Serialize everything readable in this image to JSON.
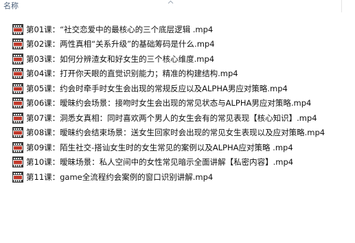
{
  "header": {
    "name_label": "名称"
  },
  "icons": {
    "sort": "sort-chevron-up-icon",
    "file": "video-file-icon"
  },
  "colors": {
    "header_text": "#4c607a",
    "file_text": "#111111",
    "icon_frame": "#3a3a3a",
    "icon_screen": "#c0392b"
  },
  "files": [
    {
      "name": "第01课：“社交恋爱中的最核心的三个底层逻辑 .mp4"
    },
    {
      "name": "第02课：两性真相“关系升级”的基础筹码是什么.mp4"
    },
    {
      "name": "第03课：如何分辨渣女和好女生的三个核心维度.mp4"
    },
    {
      "name": "第04课：打开你天眼的直觉识别能力；精准的构建结构.mp4"
    },
    {
      "name": "第05课：约会时牵手时女生会出现的常规反应以及ALPHA男应对策略.mp4"
    },
    {
      "name": "第06课：暧昧约会场景：接吻时女生会出现的常见状态与ALPHA男应对策略.mp4"
    },
    {
      "name": "第07课：洞悉女真相：同时喜欢两个男人的女生会有的常见表现【核心知识】.mp4"
    },
    {
      "name": "第08课：暧昧约会结束场景：送女生回家时会出现的常见女生表现以及应对策略.mp4"
    },
    {
      "name": "第09课：陌生社交-搭讪女生时的女生常见的案例以及ALPHA应对策略 .mp4"
    },
    {
      "name": "第10课：暧昧场景：私人空间中的女性常见暗示全面讲解【私密内容】.mp4"
    },
    {
      "name": "第11课：game全流程约会案例的窗口识别讲解.mp4"
    }
  ]
}
